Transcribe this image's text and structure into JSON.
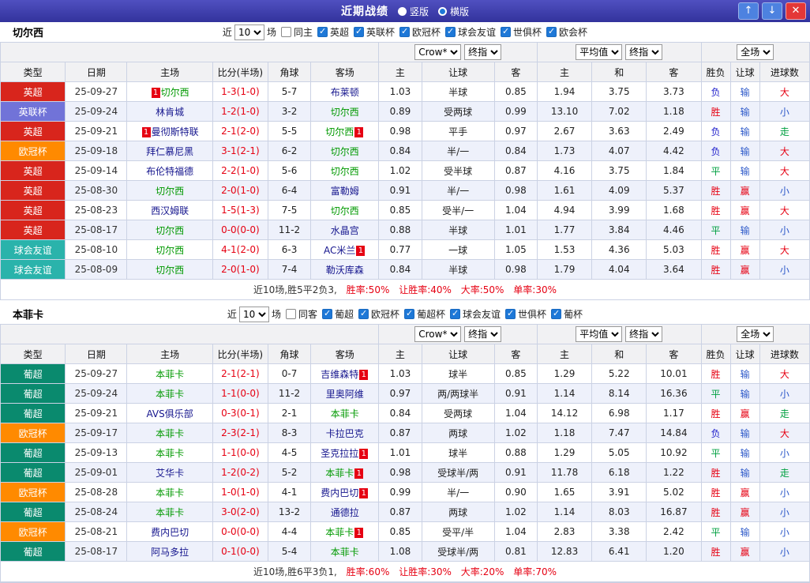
{
  "titlebar": {
    "title": "近期战绩",
    "layout_options": [
      {
        "label": "竖版",
        "selected": false
      },
      {
        "label": "横版",
        "selected": true
      }
    ],
    "buttons": {
      "up": "↑",
      "down": "↓",
      "close": "✕"
    }
  },
  "columns": [
    "类型",
    "日期",
    "主场",
    "比分(半场)",
    "角球",
    "客场",
    "主",
    "让球",
    "客",
    "主",
    "和",
    "客",
    "胜负",
    "让球",
    "进球数"
  ],
  "selects": {
    "bookmaker": "Crow*",
    "final": "终指",
    "average": "平均值",
    "scope": "全场"
  },
  "colors": {
    "league": {
      "英超": "#d8251c",
      "英联杯": "#7173d8",
      "欧冠杯": "#ff8a00",
      "球会友谊": "#2ab3ab",
      "葡超": "#0a8a6e"
    },
    "result": {
      "胜": "#e60012",
      "平": "#00a040",
      "负": "#2222cc"
    },
    "handicap_result": {
      "赢": "#e60012",
      "输": "#2d59c9",
      "走": "#00a040"
    },
    "goals_result": {
      "大": "#e60012",
      "小": "#2d59c9",
      "走": "#00a040"
    },
    "focal_team": "#009900",
    "opponent_team": "#16168e",
    "score": "#e60012",
    "header_bar": "#32329c"
  },
  "sections": [
    {
      "team": "切尔西",
      "filters": {
        "near_label": "近",
        "count": "10",
        "games_label": "场",
        "same_venue": {
          "label": "同主",
          "checked": false
        },
        "leagues": [
          {
            "label": "英超",
            "checked": true
          },
          {
            "label": "英联杯",
            "checked": true
          },
          {
            "label": "欧冠杯",
            "checked": true
          },
          {
            "label": "球会友谊",
            "checked": true
          },
          {
            "label": "世俱杯",
            "checked": true
          },
          {
            "label": "欧会杯",
            "checked": true
          }
        ]
      },
      "rows": [
        {
          "league": "英超",
          "date": "25-09-27",
          "home": "切尔西",
          "home_focal": true,
          "home_cards": 1,
          "score": "1-3(1-0)",
          "corners": "5-7",
          "away": "布莱顿",
          "away_focal": false,
          "away_cards": 0,
          "odds_home": "1.03",
          "handicap": "半球",
          "odds_away": "0.85",
          "avg_home": "1.94",
          "avg_draw": "3.75",
          "avg_away": "3.73",
          "result": "负",
          "handicap_result": "输",
          "goals_result": "大"
        },
        {
          "league": "英联杯",
          "date": "25-09-24",
          "home": "林肯城",
          "home_focal": false,
          "home_cards": 0,
          "score": "1-2(1-0)",
          "corners": "3-2",
          "away": "切尔西",
          "away_focal": true,
          "away_cards": 0,
          "odds_home": "0.89",
          "handicap": "受两球",
          "odds_away": "0.99",
          "avg_home": "13.10",
          "avg_draw": "7.02",
          "avg_away": "1.18",
          "result": "胜",
          "handicap_result": "输",
          "goals_result": "小"
        },
        {
          "league": "英超",
          "date": "25-09-21",
          "home": "曼彻斯特联",
          "home_focal": false,
          "home_cards": 1,
          "score": "2-1(2-0)",
          "corners": "5-5",
          "away": "切尔西",
          "away_focal": true,
          "away_cards": 1,
          "odds_home": "0.98",
          "handicap": "平手",
          "odds_away": "0.97",
          "avg_home": "2.67",
          "avg_draw": "3.63",
          "avg_away": "2.49",
          "result": "负",
          "handicap_result": "输",
          "goals_result": "走"
        },
        {
          "league": "欧冠杯",
          "date": "25-09-18",
          "home": "拜仁慕尼黑",
          "home_focal": false,
          "home_cards": 0,
          "score": "3-1(2-1)",
          "corners": "6-2",
          "away": "切尔西",
          "away_focal": true,
          "away_cards": 0,
          "odds_home": "0.84",
          "handicap": "半/一",
          "odds_away": "0.84",
          "avg_home": "1.73",
          "avg_draw": "4.07",
          "avg_away": "4.42",
          "result": "负",
          "handicap_result": "输",
          "goals_result": "大"
        },
        {
          "league": "英超",
          "date": "25-09-14",
          "home": "布伦特福德",
          "home_focal": false,
          "home_cards": 0,
          "score": "2-2(1-0)",
          "corners": "5-6",
          "away": "切尔西",
          "away_focal": true,
          "away_cards": 0,
          "odds_home": "1.02",
          "handicap": "受半球",
          "odds_away": "0.87",
          "avg_home": "4.16",
          "avg_draw": "3.75",
          "avg_away": "1.84",
          "result": "平",
          "handicap_result": "输",
          "goals_result": "大"
        },
        {
          "league": "英超",
          "date": "25-08-30",
          "home": "切尔西",
          "home_focal": true,
          "home_cards": 0,
          "score": "2-0(1-0)",
          "corners": "6-4",
          "away": "富勒姆",
          "away_focal": false,
          "away_cards": 0,
          "odds_home": "0.91",
          "handicap": "半/一",
          "odds_away": "0.98",
          "avg_home": "1.61",
          "avg_draw": "4.09",
          "avg_away": "5.37",
          "result": "胜",
          "handicap_result": "赢",
          "goals_result": "小"
        },
        {
          "league": "英超",
          "date": "25-08-23",
          "home": "西汉姆联",
          "home_focal": false,
          "home_cards": 0,
          "score": "1-5(1-3)",
          "corners": "7-5",
          "away": "切尔西",
          "away_focal": true,
          "away_cards": 0,
          "odds_home": "0.85",
          "handicap": "受半/一",
          "odds_away": "1.04",
          "avg_home": "4.94",
          "avg_draw": "3.99",
          "avg_away": "1.68",
          "result": "胜",
          "handicap_result": "赢",
          "goals_result": "大"
        },
        {
          "league": "英超",
          "date": "25-08-17",
          "home": "切尔西",
          "home_focal": true,
          "home_cards": 0,
          "score": "0-0(0-0)",
          "corners": "11-2",
          "away": "水晶宫",
          "away_focal": false,
          "away_cards": 0,
          "odds_home": "0.88",
          "handicap": "半球",
          "odds_away": "1.01",
          "avg_home": "1.77",
          "avg_draw": "3.84",
          "avg_away": "4.46",
          "result": "平",
          "handicap_result": "输",
          "goals_result": "小"
        },
        {
          "league": "球会友谊",
          "date": "25-08-10",
          "home": "切尔西",
          "home_focal": true,
          "home_cards": 0,
          "score": "4-1(2-0)",
          "corners": "6-3",
          "away": "AC米兰",
          "away_focal": false,
          "away_cards": 1,
          "odds_home": "0.77",
          "handicap": "一球",
          "odds_away": "1.05",
          "avg_home": "1.53",
          "avg_draw": "4.36",
          "avg_away": "5.03",
          "result": "胜",
          "handicap_result": "赢",
          "goals_result": "大"
        },
        {
          "league": "球会友谊",
          "date": "25-08-09",
          "home": "切尔西",
          "home_focal": true,
          "home_cards": 0,
          "score": "2-0(1-0)",
          "corners": "7-4",
          "away": "勒沃库森",
          "away_focal": false,
          "away_cards": 0,
          "odds_home": "0.84",
          "handicap": "半球",
          "odds_away": "0.98",
          "avg_home": "1.79",
          "avg_draw": "4.04",
          "avg_away": "3.64",
          "result": "胜",
          "handicap_result": "赢",
          "goals_result": "小"
        }
      ],
      "summary": {
        "record": "近10场,胜5平2负3,",
        "rates": [
          "胜率:50%",
          "让胜率:40%",
          "大率:50%",
          "单率:30%"
        ]
      }
    },
    {
      "team": "本菲卡",
      "filters": {
        "near_label": "近",
        "count": "10",
        "games_label": "场",
        "same_venue": {
          "label": "同客",
          "checked": false
        },
        "leagues": [
          {
            "label": "葡超",
            "checked": true
          },
          {
            "label": "欧冠杯",
            "checked": true
          },
          {
            "label": "葡超杯",
            "checked": true
          },
          {
            "label": "球会友谊",
            "checked": true
          },
          {
            "label": "世俱杯",
            "checked": true
          },
          {
            "label": "葡杯",
            "checked": true
          }
        ]
      },
      "rows": [
        {
          "league": "葡超",
          "date": "25-09-27",
          "home": "本菲卡",
          "home_focal": true,
          "home_cards": 0,
          "score": "2-1(2-1)",
          "corners": "0-7",
          "away": "吉维森特",
          "away_focal": false,
          "away_cards": 1,
          "odds_home": "1.03",
          "handicap": "球半",
          "odds_away": "0.85",
          "avg_home": "1.29",
          "avg_draw": "5.22",
          "avg_away": "10.01",
          "result": "胜",
          "handicap_result": "输",
          "goals_result": "大"
        },
        {
          "league": "葡超",
          "date": "25-09-24",
          "home": "本菲卡",
          "home_focal": true,
          "home_cards": 0,
          "score": "1-1(0-0)",
          "corners": "11-2",
          "away": "里奥阿维",
          "away_focal": false,
          "away_cards": 0,
          "odds_home": "0.97",
          "handicap": "两/两球半",
          "odds_away": "0.91",
          "avg_home": "1.14",
          "avg_draw": "8.14",
          "avg_away": "16.36",
          "result": "平",
          "handicap_result": "输",
          "goals_result": "小"
        },
        {
          "league": "葡超",
          "date": "25-09-21",
          "home": "AVS俱乐部",
          "home_focal": false,
          "home_cards": 0,
          "score": "0-3(0-1)",
          "corners": "2-1",
          "away": "本菲卡",
          "away_focal": true,
          "away_cards": 0,
          "odds_home": "0.84",
          "handicap": "受两球",
          "odds_away": "1.04",
          "avg_home": "14.12",
          "avg_draw": "6.98",
          "avg_away": "1.17",
          "result": "胜",
          "handicap_result": "赢",
          "goals_result": "走"
        },
        {
          "league": "欧冠杯",
          "date": "25-09-17",
          "home": "本菲卡",
          "home_focal": true,
          "home_cards": 0,
          "score": "2-3(2-1)",
          "corners": "8-3",
          "away": "卡拉巴克",
          "away_focal": false,
          "away_cards": 0,
          "odds_home": "0.87",
          "handicap": "两球",
          "odds_away": "1.02",
          "avg_home": "1.18",
          "avg_draw": "7.47",
          "avg_away": "14.84",
          "result": "负",
          "handicap_result": "输",
          "goals_result": "大"
        },
        {
          "league": "葡超",
          "date": "25-09-13",
          "home": "本菲卡",
          "home_focal": true,
          "home_cards": 0,
          "score": "1-1(0-0)",
          "corners": "4-5",
          "away": "圣克拉拉",
          "away_focal": false,
          "away_cards": 1,
          "odds_home": "1.01",
          "handicap": "球半",
          "odds_away": "0.88",
          "avg_home": "1.29",
          "avg_draw": "5.05",
          "avg_away": "10.92",
          "result": "平",
          "handicap_result": "输",
          "goals_result": "小"
        },
        {
          "league": "葡超",
          "date": "25-09-01",
          "home": "艾华卡",
          "home_focal": false,
          "home_cards": 0,
          "score": "1-2(0-2)",
          "corners": "5-2",
          "away": "本菲卡",
          "away_focal": true,
          "away_cards": 1,
          "odds_home": "0.98",
          "handicap": "受球半/两",
          "odds_away": "0.91",
          "avg_home": "11.78",
          "avg_draw": "6.18",
          "avg_away": "1.22",
          "result": "胜",
          "handicap_result": "输",
          "goals_result": "走"
        },
        {
          "league": "欧冠杯",
          "date": "25-08-28",
          "home": "本菲卡",
          "home_focal": true,
          "home_cards": 0,
          "score": "1-0(1-0)",
          "corners": "4-1",
          "away": "费内巴切",
          "away_focal": false,
          "away_cards": 1,
          "odds_home": "0.99",
          "handicap": "半/一",
          "odds_away": "0.90",
          "avg_home": "1.65",
          "avg_draw": "3.91",
          "avg_away": "5.02",
          "result": "胜",
          "handicap_result": "赢",
          "goals_result": "小"
        },
        {
          "league": "葡超",
          "date": "25-08-24",
          "home": "本菲卡",
          "home_focal": true,
          "home_cards": 0,
          "score": "3-0(2-0)",
          "corners": "13-2",
          "away": "通德拉",
          "away_focal": false,
          "away_cards": 0,
          "odds_home": "0.87",
          "handicap": "两球",
          "odds_away": "1.02",
          "avg_home": "1.14",
          "avg_draw": "8.03",
          "avg_away": "16.87",
          "result": "胜",
          "handicap_result": "赢",
          "goals_result": "小"
        },
        {
          "league": "欧冠杯",
          "date": "25-08-21",
          "home": "费内巴切",
          "home_focal": false,
          "home_cards": 0,
          "score": "0-0(0-0)",
          "corners": "4-4",
          "away": "本菲卡",
          "away_focal": true,
          "away_cards": 1,
          "odds_home": "0.85",
          "handicap": "受平/半",
          "odds_away": "1.04",
          "avg_home": "2.83",
          "avg_draw": "3.38",
          "avg_away": "2.42",
          "result": "平",
          "handicap_result": "输",
          "goals_result": "小"
        },
        {
          "league": "葡超",
          "date": "25-08-17",
          "home": "阿马多拉",
          "home_focal": false,
          "home_cards": 0,
          "score": "0-1(0-0)",
          "corners": "5-4",
          "away": "本菲卡",
          "away_focal": true,
          "away_cards": 0,
          "odds_home": "1.08",
          "handicap": "受球半/两",
          "odds_away": "0.81",
          "avg_home": "12.83",
          "avg_draw": "6.41",
          "avg_away": "1.20",
          "result": "胜",
          "handicap_result": "赢",
          "goals_result": "小"
        }
      ],
      "summary": {
        "record": "近10场,胜6平3负1,",
        "rates": [
          "胜率:60%",
          "让胜率:30%",
          "大率:20%",
          "单率:70%"
        ]
      }
    }
  ]
}
